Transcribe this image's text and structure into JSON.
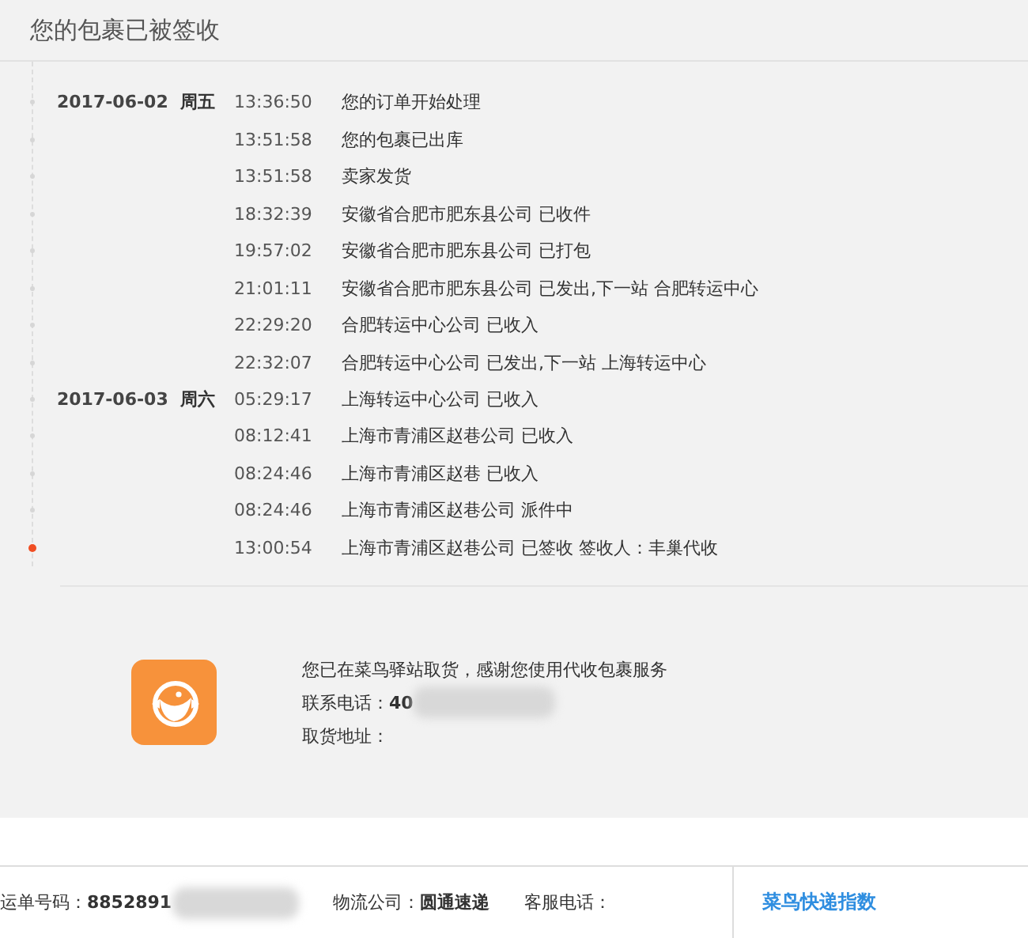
{
  "header": {
    "title": "您的包裹已被签收"
  },
  "days": [
    {
      "date": "2017-06-02",
      "weekday": "周五",
      "events": [
        {
          "time": "13:36:50",
          "text": "您的订单开始处理",
          "current": false
        },
        {
          "time": "13:51:58",
          "text": "您的包裹已出库",
          "current": false
        },
        {
          "time": "13:51:58",
          "text": "卖家发货",
          "current": false
        },
        {
          "time": "18:32:39",
          "text": "安徽省合肥市肥东县公司 已收件",
          "current": false
        },
        {
          "time": "19:57:02",
          "text": "安徽省合肥市肥东县公司 已打包",
          "current": false
        },
        {
          "time": "21:01:11",
          "text": "安徽省合肥市肥东县公司 已发出,下一站 合肥转运中心",
          "current": false
        },
        {
          "time": "22:29:20",
          "text": "合肥转运中心公司 已收入",
          "current": false
        },
        {
          "time": "22:32:07",
          "text": "合肥转运中心公司 已发出,下一站 上海转运中心",
          "current": false
        }
      ]
    },
    {
      "date": "2017-06-03",
      "weekday": "周六",
      "events": [
        {
          "time": "05:29:17",
          "text": "上海转运中心公司 已收入",
          "current": false
        },
        {
          "time": "08:12:41",
          "text": "上海市青浦区赵巷公司 已收入",
          "current": false
        },
        {
          "time": "08:24:46",
          "text": "上海市青浦区赵巷 已收入",
          "current": false
        },
        {
          "time": "08:24:46",
          "text": "上海市青浦区赵巷公司 派件中",
          "current": false
        },
        {
          "time": "13:00:54",
          "text": "上海市青浦区赵巷公司 已签收 签收人：丰巢代收",
          "current": true
        }
      ]
    }
  ],
  "pickup": {
    "message": "您已在菜鸟驿站取货，感谢您使用代收包裹服务",
    "phone_label": "联系电话：",
    "phone_value": "40",
    "address_label": "取货地址："
  },
  "footer": {
    "tracking_label": "运单号码：",
    "tracking_value": "8852891",
    "company_label": "物流公司：",
    "company_value": "圆通速递",
    "service_label": "客服电话：",
    "link": "菜鸟快递指数"
  }
}
